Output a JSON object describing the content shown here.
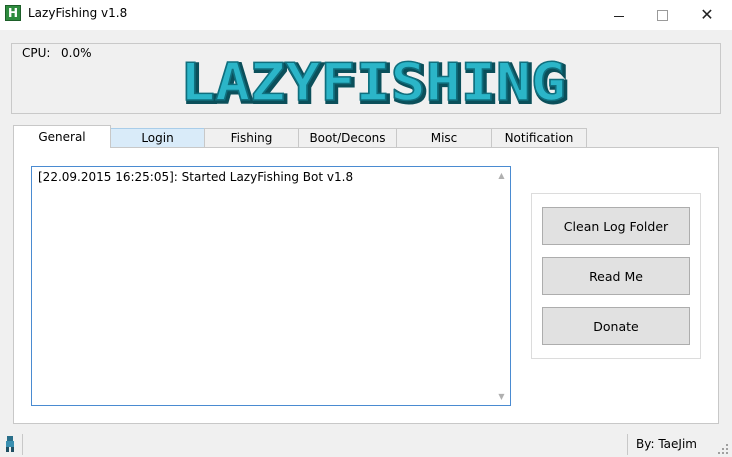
{
  "window": {
    "title": "LazyFishing v1.8",
    "icon_letter": "H"
  },
  "header": {
    "cpu_label": "CPU:",
    "cpu_value": "0.0%",
    "logo_text": "LAZYFISHING",
    "logo_color": "#2bb5c8"
  },
  "tabs": [
    {
      "label": "General"
    },
    {
      "label": "Login"
    },
    {
      "label": "Fishing"
    },
    {
      "label": "Boot/Decons"
    },
    {
      "label": "Misc"
    },
    {
      "label": "Notification"
    }
  ],
  "log": {
    "lines": [
      "[22.09.2015 16:25:05]: Started LazyFishing Bot v1.8"
    ]
  },
  "buttons": {
    "clean_log": "Clean Log Folder",
    "read_me": "Read Me",
    "donate": "Donate"
  },
  "status": {
    "author": "By: TaeJim"
  }
}
